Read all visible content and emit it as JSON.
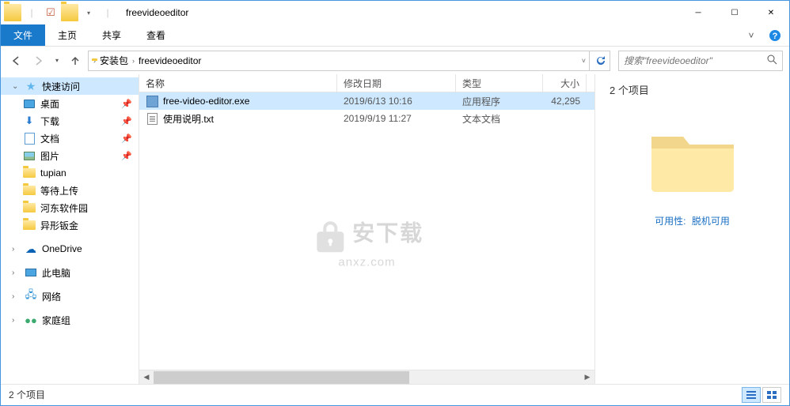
{
  "window": {
    "title": "freevideoeditor"
  },
  "ribbon": {
    "file": "文件",
    "home": "主页",
    "share": "共享",
    "view": "查看"
  },
  "breadcrumb": {
    "seg1": "安装包",
    "seg2": "freevideoeditor"
  },
  "search": {
    "placeholder": "搜索\"freevideoeditor\""
  },
  "sidebar": {
    "quick": "快速访问",
    "desktop": "桌面",
    "downloads": "下载",
    "documents": "文档",
    "pictures": "图片",
    "tupian": "tupian",
    "pending": "等待上传",
    "hedong": "河东软件园",
    "yixing": "异形钣金",
    "onedrive": "OneDrive",
    "thispc": "此电脑",
    "network": "网络",
    "homegroup": "家庭组"
  },
  "columns": {
    "name": "名称",
    "date": "修改日期",
    "type": "类型",
    "size": "大小"
  },
  "files": [
    {
      "name": "free-video-editor.exe",
      "date": "2019/6/13 10:16",
      "type": "应用程序",
      "size": "42,295",
      "icon": "exe",
      "selected": true
    },
    {
      "name": "使用说明.txt",
      "date": "2019/9/19 11:27",
      "type": "文本文档",
      "size": "",
      "icon": "txt",
      "selected": false
    }
  ],
  "preview": {
    "count": "2 个项目",
    "avail_label": "可用性:",
    "avail_value": "脱机可用"
  },
  "status": {
    "text": "2 个项目"
  },
  "watermark": {
    "text": "安下载",
    "sub": "anxz.com"
  }
}
